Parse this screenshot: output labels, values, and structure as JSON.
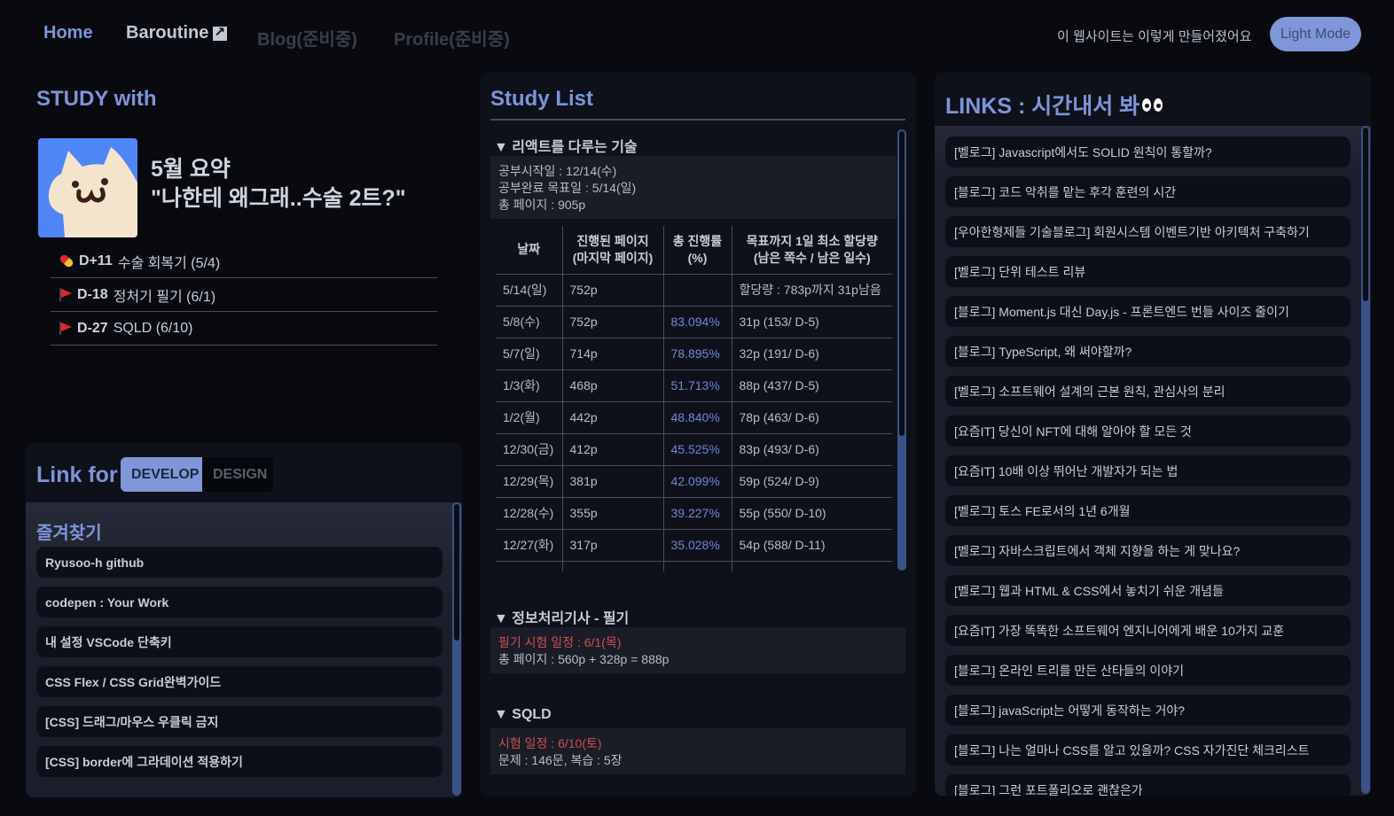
{
  "nav": {
    "home": "Home",
    "baroutine": "Baroutine",
    "blog": "Blog(준비중)",
    "profile": "Profile(준비중)",
    "about": "이 웹사이트는 이렇게 만들어졌어요",
    "mode_button": "Light Mode"
  },
  "study": {
    "title": "STUDY with",
    "summary_line1": "5월 요약",
    "summary_line2": "\"나한테 왜그래..수술 2트?\"",
    "ddays": [
      {
        "icon": "pill-icon",
        "count": "D+11",
        "label": "수술 회복기 (5/4)"
      },
      {
        "icon": "flag-icon",
        "count": "D-18",
        "label": "정처기 필기 (6/1)"
      },
      {
        "icon": "flag-icon",
        "count": "D-27",
        "label": "SQLD (6/10)"
      }
    ]
  },
  "linkfor": {
    "title": "Link for",
    "tabs": [
      {
        "label": "DEVELOP",
        "active": true
      },
      {
        "label": "DESIGN",
        "active": false
      }
    ],
    "favorites_title": "즐겨찾기",
    "favorites": [
      "Ryusoo-h github",
      "codepen : Your Work",
      "내 설정 VSCode 단축키",
      "CSS Flex / CSS Grid완벽가이드",
      "[CSS] 드래그/마우스 우클릭 금지",
      "[CSS] border에 그라데이션 적용하기"
    ]
  },
  "studylist": {
    "title": "Study List",
    "sections": [
      {
        "title": "▼ 리액트를 다루는 기술",
        "info": [
          "공부시작일 : 12/14(수)",
          "공부완료 목표일 : 5/14(일)",
          "총 페이지 : 905p"
        ]
      },
      {
        "title": "▼ 정보처리기사 - 필기",
        "info_red": "필기 시험 일정 : 6/1(목)",
        "info": [
          "총 페이지 : 560p + 328p = 888p"
        ]
      },
      {
        "title": "▼ SQLD",
        "info_red": "시험 일정 : 6/10(토)",
        "info": [
          "문제 : 146문, 복습 : 5장"
        ]
      }
    ],
    "table": {
      "headers": [
        "날짜",
        "진행된 페이지\n(마지막 페이지)",
        "총 진행률\n(%)",
        "목표까지 1일 최소 할당량\n(남은 쪽수 / 남은 일수)"
      ],
      "rows": [
        [
          "5/14(일)",
          "752p",
          "",
          "할당량 : 783p까지 31p남음"
        ],
        [
          "5/8(수)",
          "752p",
          "83.094%",
          "31p (153/ D-5)"
        ],
        [
          "5/7(일)",
          "714p",
          "78.895%",
          "32p (191/ D-6)"
        ],
        [
          "1/3(화)",
          "468p",
          "51.713%",
          "88p (437/ D-5)"
        ],
        [
          "1/2(월)",
          "442p",
          "48.840%",
          "78p (463/ D-6)"
        ],
        [
          "12/30(금)",
          "412p",
          "45.525%",
          "83p (493/ D-6)"
        ],
        [
          "12/29(목)",
          "381p",
          "42.099%",
          "59p (524/ D-9)"
        ],
        [
          "12/28(수)",
          "355p",
          "39.227%",
          "55p (550/ D-10)"
        ],
        [
          "12/27(화)",
          "317p",
          "35.028%",
          "54p (588/ D-11)"
        ]
      ]
    }
  },
  "links": {
    "title": "LINKS : 시간내서 봐",
    "items": [
      "[벨로그] Javascript에서도 SOLID 원칙이 통할까?",
      "[블로그] 코드 악취를 맡는 후각 훈련의 시간",
      "[우아한형제들 기술블로그] 회원시스템 이벤트기반 아키텍처 구축하기",
      "[벨로그] 단위 테스트 리뷰",
      "[블로그] Moment.js 대신 Day.js - 프론트엔드 번들 사이즈 줄이기",
      "[블로그] TypeScript, 왜 써야할까?",
      "[벨로그] 소프트웨어 설계의 근본 원칙, 관심사의 분리",
      "[요즘IT] 당신이 NFT에 대해 알아야 할 모든 것",
      "[요즘IT] 10배 이상 뛰어난 개발자가 되는 법",
      "[벨로그] 토스 FE로서의 1년 6개월",
      "[벨로그] 자바스크립트에서 객체 지향을 하는 게 맞나요?",
      "[벨로그] 웹과 HTML & CSS에서 놓치기 쉬운 개념들",
      "[요즘IT] 가장 똑똑한 소프트웨어 엔지니어에게 배운 10가지 교훈",
      "[블로그] 온라인 트리를 만든 산타들의 이야기",
      "[블로그] javaScript는 어떻게 동작하는 거야?",
      "[블로그] 나는 얼마나 CSS를 알고 있을까? CSS 자가진단 체크리스트",
      "[블로그] 그런 포트폴리오로 괜찮은가"
    ]
  }
}
